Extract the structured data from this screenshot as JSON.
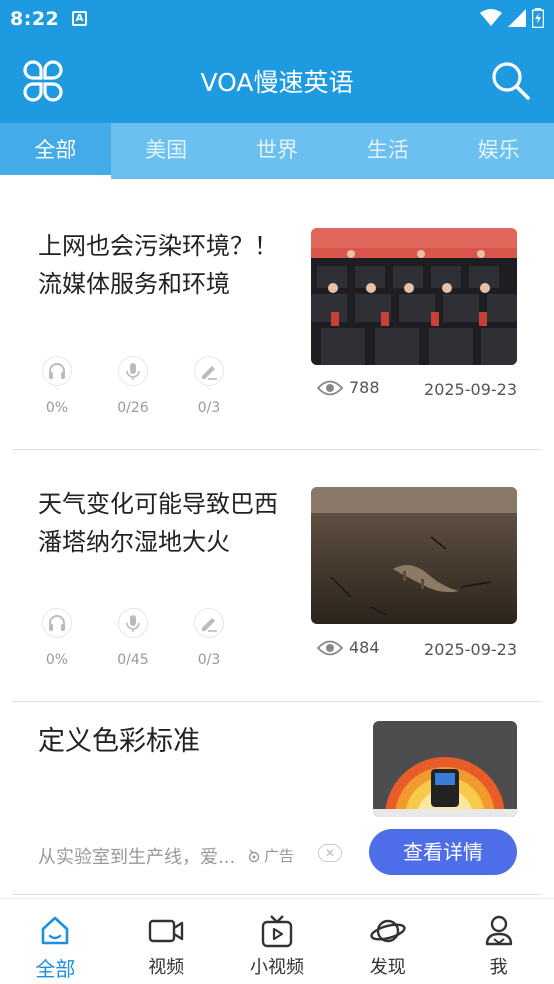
{
  "status_bar": {
    "time": "8:22",
    "notification_icon": "A"
  },
  "header": {
    "title": "VOA慢速英语"
  },
  "categories": [
    "全部",
    "美国",
    "世界",
    "生活",
    "娱乐"
  ],
  "articles": [
    {
      "title": "上网也会污染环境？！ 流媒体服务和环境",
      "listen": "0%",
      "speak": "0/26",
      "write": "0/3",
      "views": "788",
      "date": "2025-09-23"
    },
    {
      "title": "天气变化可能导致巴西潘塔纳尔湿地大火",
      "listen": "0%",
      "speak": "0/45",
      "write": "0/3",
      "views": "484",
      "date": "2025-09-23"
    }
  ],
  "ad": {
    "title": "定义色彩标准",
    "description": "从实验室到生产线，爱...",
    "label": "广告",
    "close": "✕",
    "cta": "查看详情"
  },
  "bottom_nav": [
    "全部",
    "视频",
    "小视频",
    "发现",
    "我"
  ],
  "colors": {
    "primary": "#1e9ae0",
    "tabs_bg": "#6cc0ef",
    "cta": "#4d6ee8",
    "active_nav": "#1e8fe0"
  }
}
